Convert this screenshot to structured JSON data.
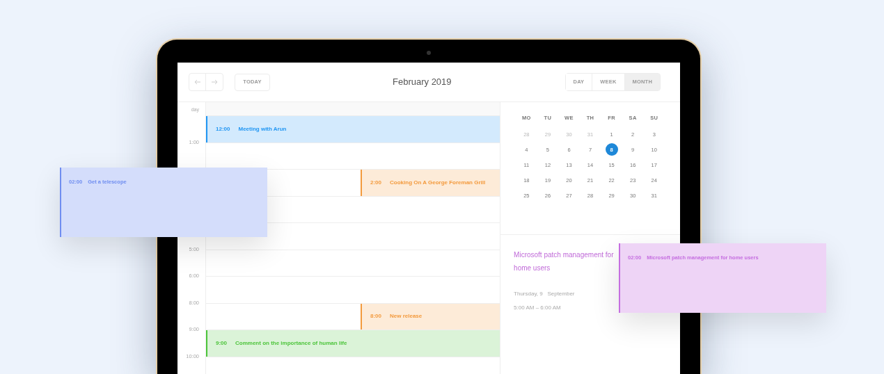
{
  "toolbar": {
    "title": "February 2019",
    "today": "TODAY",
    "views": [
      {
        "label": "DAY",
        "selected": false
      },
      {
        "label": "WEEK",
        "selected": false
      },
      {
        "label": "MONTH",
        "selected": true
      }
    ]
  },
  "day_view": {
    "header": "day",
    "slots": [
      {
        "kind": "slot",
        "event": {
          "time": "12:00",
          "title": "Meeting with Arun",
          "color": "#2196f3",
          "kind": "full"
        }
      },
      {
        "kind": "slot",
        "label": "1:00"
      },
      {
        "kind": "slot",
        "event": {
          "time": "2:00",
          "title": "Cooking On A George Foreman Grill",
          "color": "#f39a3d",
          "kind": "half"
        }
      },
      {
        "kind": "slot"
      },
      {
        "kind": "slot"
      },
      {
        "kind": "slot",
        "label": "5:00"
      },
      {
        "kind": "slot",
        "label": "6:00"
      },
      {
        "kind": "slot",
        "label": "8:00",
        "event": {
          "time": "8:00",
          "title": "New release",
          "color": "#f39a3d",
          "kind": "half"
        }
      },
      {
        "kind": "slot",
        "label": "9:00",
        "event": {
          "time": "9:00",
          "title": "Comment on the importance of human life",
          "color": "#4cc43a",
          "kind": "full"
        }
      },
      {
        "kind": "slot",
        "label": "10:00"
      }
    ]
  },
  "month": {
    "weekdays": [
      "MO",
      "TU",
      "WE",
      "TH",
      "FR",
      "SA",
      "SU"
    ],
    "weeks": [
      [
        {
          "day": "28",
          "outside": true,
          "selected": false
        },
        {
          "day": "29",
          "outside": true,
          "selected": false
        },
        {
          "day": "30",
          "outside": true,
          "selected": false
        },
        {
          "day": "31",
          "outside": true,
          "selected": false
        },
        {
          "day": "1",
          "outside": false,
          "selected": false
        },
        {
          "day": "2",
          "outside": false,
          "selected": false
        },
        {
          "day": "3",
          "outside": false,
          "selected": false
        }
      ],
      [
        {
          "day": "4",
          "outside": false,
          "selected": false
        },
        {
          "day": "5",
          "outside": false,
          "selected": false
        },
        {
          "day": "6",
          "outside": false,
          "selected": false
        },
        {
          "day": "7",
          "outside": false,
          "selected": false
        },
        {
          "day": "8",
          "outside": false,
          "selected": true
        },
        {
          "day": "9",
          "outside": false,
          "selected": false
        },
        {
          "day": "10",
          "outside": false,
          "selected": false
        }
      ],
      [
        {
          "day": "11",
          "outside": false,
          "selected": false
        },
        {
          "day": "12",
          "outside": false,
          "selected": false
        },
        {
          "day": "13",
          "outside": false,
          "selected": false
        },
        {
          "day": "14",
          "outside": false,
          "selected": false
        },
        {
          "day": "15",
          "outside": false,
          "selected": false
        },
        {
          "day": "16",
          "outside": false,
          "selected": false
        },
        {
          "day": "17",
          "outside": false,
          "selected": false
        }
      ],
      [
        {
          "day": "18",
          "outside": false,
          "selected": false
        },
        {
          "day": "19",
          "outside": false,
          "selected": false
        },
        {
          "day": "20",
          "outside": false,
          "selected": false
        },
        {
          "day": "21",
          "outside": false,
          "selected": false
        },
        {
          "day": "22",
          "outside": false,
          "selected": false
        },
        {
          "day": "23",
          "outside": false,
          "selected": false
        },
        {
          "day": "24",
          "outside": false,
          "selected": false
        }
      ],
      [
        {
          "day": "25",
          "outside": false,
          "selected": false
        },
        {
          "day": "26",
          "outside": false,
          "selected": false
        },
        {
          "day": "27",
          "outside": false,
          "selected": false
        },
        {
          "day": "28",
          "outside": false,
          "selected": false
        },
        {
          "day": "29",
          "outside": false,
          "selected": false
        },
        {
          "day": "30",
          "outside": false,
          "selected": false
        },
        {
          "day": "31",
          "outside": false,
          "selected": false
        }
      ]
    ]
  },
  "event_detail": {
    "title": "Microsoft patch management for home users",
    "date": "Thursday, 9   September",
    "time_range": "5:00 AM – 6:00 AM"
  },
  "floating_cards": [
    {
      "time": "02:00",
      "title": "Get a telescope",
      "color": "#6f8df0"
    },
    {
      "time": "02:00",
      "title": "Microsoft patch management for home users",
      "color": "#c56ee0"
    }
  ]
}
